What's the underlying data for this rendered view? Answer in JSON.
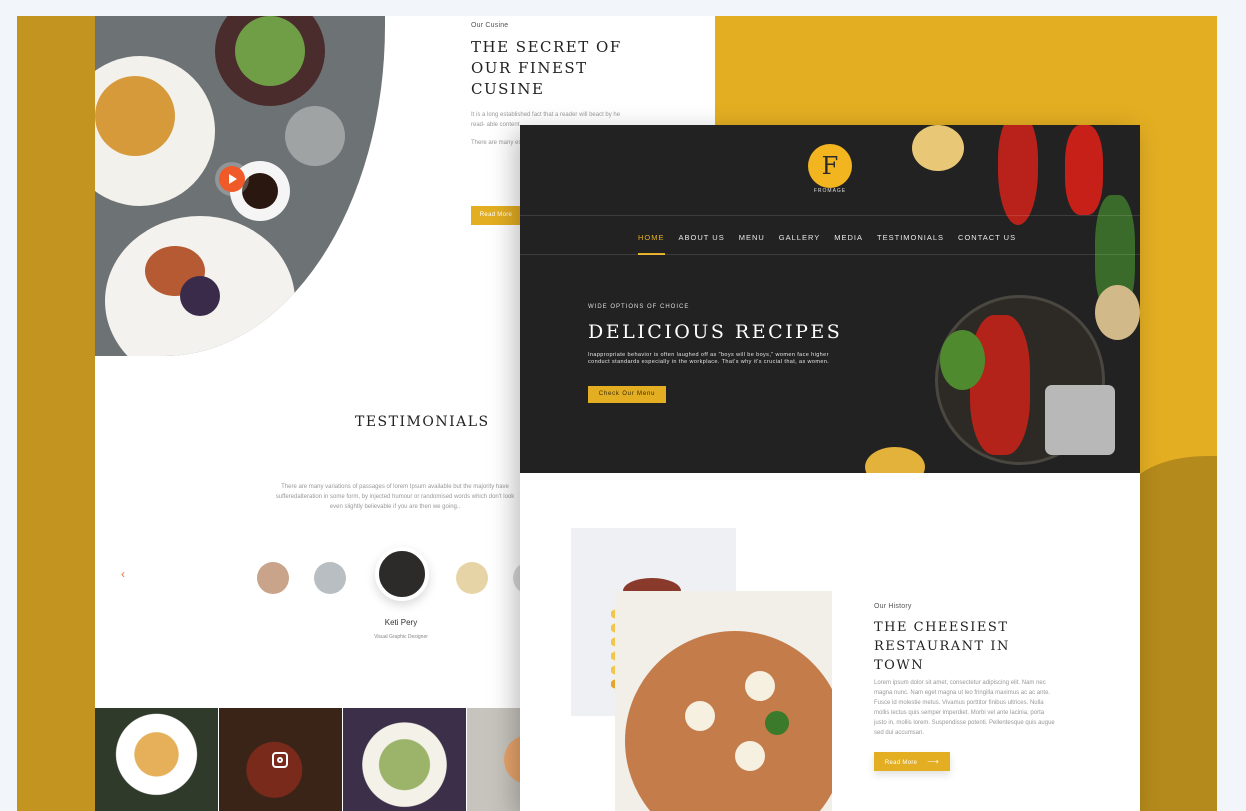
{
  "theme": {
    "accent": "#e3ae22",
    "orange": "#f05a28",
    "dark": "#222222"
  },
  "back_page": {
    "cuisine": {
      "kicker": "Our Cusine",
      "title": "The Secret of Our Finest Cusine",
      "para1": "It is a long established fact that a reader will beact by he read- able content..",
      "para2": "There are many est (pacsable bu alteration in som ur or rando mise",
      "button": "Read More"
    },
    "testimonials": {
      "title": "Testimonials",
      "text": "There are many variations of passages of lorem Ipsum available but the majority have sufferedalteration in some form, by injected humour or randomised words which don't look even slightly believable if you are then we going..",
      "person_name": "Keti Pery",
      "person_role": "Visual Graphic Designer"
    },
    "gallery": {
      "icon": "instagram-icon"
    }
  },
  "front_page": {
    "logo": {
      "letter": "F",
      "name": "FROMAGE"
    },
    "nav": [
      "HOME",
      "ABOUT US",
      "MENU",
      "GALLERY",
      "MEDIA",
      "TESTIMONIALS",
      "CONTACT US"
    ],
    "nav_active": "HOME",
    "hero": {
      "kicker": "WIDE OPTIONS OF CHOICE",
      "title": "Delicious Recipes",
      "text": "Inappropriate behavior is often laughed off as \"boys will be boys,\" women face higher conduct standards especially in the workplace. That's why it's crucial that, as women.",
      "button": "Check Our Menu"
    },
    "history": {
      "kicker": "Our History",
      "title": "The Cheesiest Restaurant in Town",
      "text": "Lorem ipsum dolor sit amet, consectetur adipiscing elit. Nam nec magna nunc. Nam eget magna ut leo fringilla maximus ac ac ante. Fusce id molestie metus. Vivamus porttitor finibus ultrices. Nulla mollis lectus quis semper imperdiet. Morbi vel ante lacinia, porta justo in, mollis lorem. Suspendisse potenti. Pellentesque quis augue sed dui accumsan.",
      "button": "Read More"
    }
  }
}
